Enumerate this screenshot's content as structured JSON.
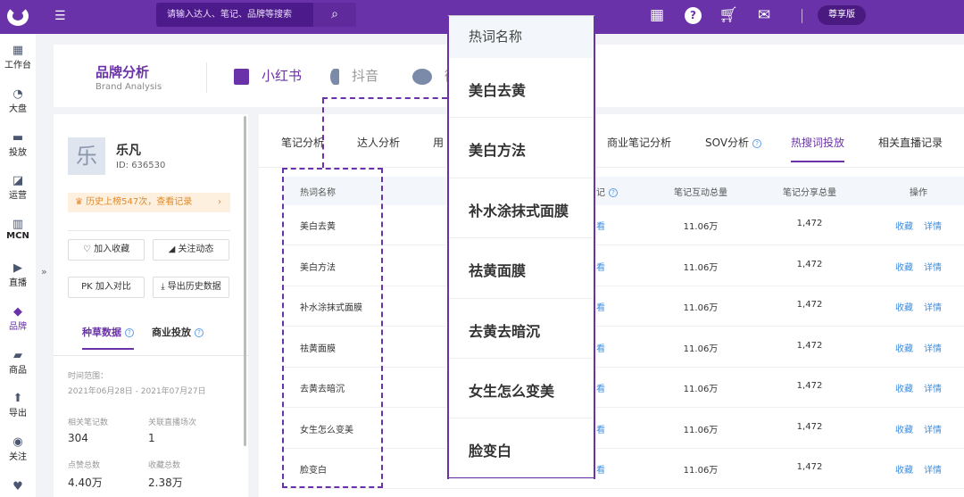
{
  "topbar": {
    "search_placeholder": "请输入达人、笔记、品牌等搜索",
    "vip_label": "尊享版"
  },
  "sidebar": {
    "items": [
      {
        "label": "工作台"
      },
      {
        "label": "大盘"
      },
      {
        "label": "投放"
      },
      {
        "label": "运营"
      },
      {
        "label": "MCN"
      },
      {
        "label": "直播"
      },
      {
        "label": "品牌"
      },
      {
        "label": "商品"
      },
      {
        "label": "导出"
      },
      {
        "label": "关注"
      }
    ],
    "expand": "»"
  },
  "header": {
    "title": "品牌分析",
    "subtitle": "Brand Analysis",
    "platforms": [
      {
        "label": "小红书",
        "color": "#6a32a8"
      },
      {
        "label": "抖音",
        "color": "#7a8aa8"
      },
      {
        "label": "微",
        "color": "#7a8aa8"
      }
    ]
  },
  "profile": {
    "avatar": "乐",
    "name": "乐凡",
    "id": "ID:  636530",
    "rank_text": "历史上榜547次，查看记录",
    "buttons": {
      "favorite": "加入收藏",
      "follow": "关注动态",
      "compare": "加入对比",
      "export": "导出历史数据"
    },
    "compare_prefix": "PK",
    "tabs": [
      "种草数据",
      "商业投放"
    ],
    "time_label": "时间范围：",
    "time_range": "2021年06月28日 - 2021年07月27日",
    "stats": [
      {
        "label": "相关笔记数",
        "value": "304"
      },
      {
        "label": "关联直播场次",
        "value": "1"
      },
      {
        "label": "点赞总数",
        "value": "4.40万"
      },
      {
        "label": "收藏总数",
        "value": "2.38万"
      }
    ]
  },
  "main": {
    "tabs": [
      "笔记分析",
      "达人分析",
      "用",
      "商业笔记分析",
      "SOV分析",
      "热搜词投放",
      "相关直播记录"
    ],
    "columns": [
      "热词名称",
      "记",
      "笔记互动总量",
      "笔记分享总量",
      "操作"
    ],
    "rows": [
      {
        "keyword": "美白去黄",
        "note": "看",
        "interact": "11.06万",
        "share": "1,472"
      },
      {
        "keyword": "美白方法",
        "note": "看",
        "interact": "11.06万",
        "share": "1,472"
      },
      {
        "keyword": "补水涂抹式面膜",
        "note": "看",
        "interact": "11.06万",
        "share": "1,472"
      },
      {
        "keyword": "祛黄面膜",
        "note": "看",
        "interact": "11.06万",
        "share": "1,472"
      },
      {
        "keyword": "去黄去暗沉",
        "note": "看",
        "interact": "11.06万",
        "share": "1,472"
      },
      {
        "keyword": "女生怎么变美",
        "note": "看",
        "interact": "11.06万",
        "share": "1,472"
      },
      {
        "keyword": "脸变白",
        "note": "看",
        "interact": "11.06万",
        "share": "1,472"
      }
    ],
    "actions": {
      "collect": "收藏",
      "detail": "详情"
    }
  },
  "popup": {
    "header": "热词名称",
    "items": [
      "美白去黄",
      "美白方法",
      "补水涂抹式面膜",
      "祛黄面膜",
      "去黄去暗沉",
      "女生怎么变美",
      "脸变白"
    ]
  },
  "colors": {
    "brand": "#6a32a8",
    "link": "#3d8ee0"
  }
}
